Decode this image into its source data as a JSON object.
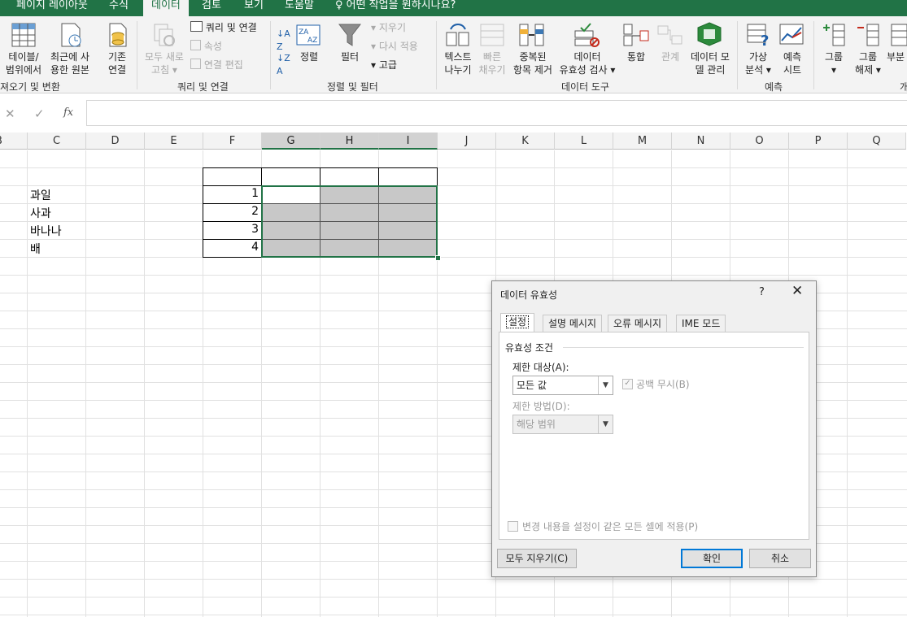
{
  "menu_tabs": [
    {
      "label": "페이지 레이아웃"
    },
    {
      "label": "수식"
    },
    {
      "label": "데이터",
      "active": true
    },
    {
      "label": "검토"
    },
    {
      "label": "보기"
    },
    {
      "label": "도움말"
    },
    {
      "label": "어떤 작업을 원하시나요?"
    }
  ],
  "ribbon": {
    "get_transform": {
      "table_range": [
        "테이블/",
        "범위에서"
      ],
      "recent_sources": [
        "최근에 사",
        "용한 원본"
      ],
      "existing_connections": [
        "기존",
        "연결"
      ],
      "group_label": "져오기 및 변환"
    },
    "queries": {
      "refresh_all": [
        "모두 새로",
        "고침 ▾"
      ],
      "queries_connections": "쿼리 및 연결",
      "properties": "속성",
      "edit_links": "연결 편집",
      "group_label": "쿼리 및 연결"
    },
    "sort_filter": {
      "sort": "정렬",
      "filter": "필터",
      "clear": "지우기",
      "reapply": "다시 적용",
      "advanced": "고급",
      "group_label": "정렬 및 필터"
    },
    "data_tools": {
      "text_to_columns": [
        "텍스트",
        "나누기"
      ],
      "flash_fill": [
        "빠른",
        "채우기"
      ],
      "remove_duplicates": [
        "중복된",
        "항목 제거"
      ],
      "data_validation": [
        "데이터",
        "유효성 검사 ▾"
      ],
      "consolidate": "통합",
      "relationships": "관계",
      "data_model": [
        "데이터 모",
        "델 관리"
      ],
      "group_label": "데이터 도구"
    },
    "forecast": {
      "what_if": [
        "가상",
        "분석 ▾"
      ],
      "forecast_sheet": [
        "예측",
        "시트"
      ],
      "group_label": "예측"
    },
    "outline": {
      "group": [
        "그룹",
        "▾"
      ],
      "ungroup": [
        "그룹",
        "해제 ▾"
      ],
      "subtotal": [
        "부분",
        ""
      ],
      "group_label": "개"
    }
  },
  "formula_bar": {
    "cancel": "✕",
    "enter": "✓",
    "fx": "fx",
    "value": ""
  },
  "columns": [
    "B",
    "C",
    "D",
    "E",
    "F",
    "G",
    "H",
    "I",
    "J",
    "K",
    "L",
    "M",
    "N",
    "O",
    "P",
    "Q"
  ],
  "cells": {
    "c_labels": [
      "과일",
      "사과",
      "바나나",
      "배"
    ],
    "f_numbers": [
      "1",
      "2",
      "3",
      "4"
    ]
  },
  "dialog": {
    "title": "데이터 유효성",
    "help": "?",
    "close": "✕",
    "tabs": [
      "설정",
      "설명 메시지",
      "오류 메시지",
      "IME 모드"
    ],
    "section_title": "유효성 조건",
    "allow_label": "제한 대상(A):",
    "allow_value": "모든 값",
    "ignore_blank": "공백 무시(B)",
    "data_label": "제한 방법(D):",
    "data_value": "해당 범위",
    "apply_all": "변경 내용을 설정이 같은 모든 셀에 적용(P)",
    "clear_all": "모두 지우기(C)",
    "ok": "확인",
    "cancel": "취소"
  }
}
